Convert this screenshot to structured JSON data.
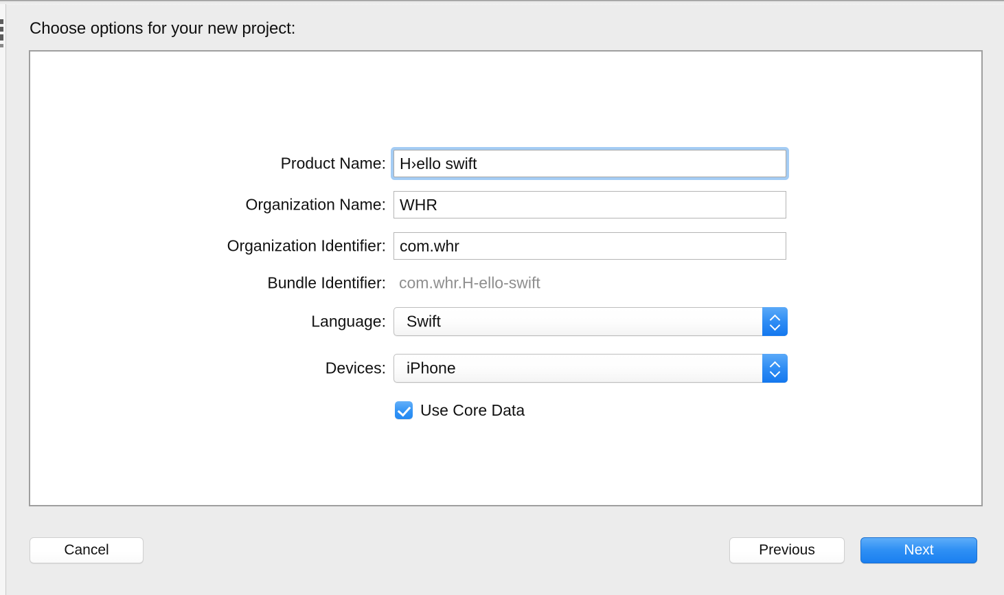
{
  "window": {
    "heading": "Choose options for your new project:"
  },
  "form": {
    "rows": [
      {
        "label": "Product Name:",
        "value": "H›ello swift",
        "type": "textfield",
        "focused": true
      },
      {
        "label": "Organization Name:",
        "value": "WHR",
        "type": "textfield",
        "focused": false
      },
      {
        "label": "Organization Identifier:",
        "value": "com.whr",
        "type": "textfield",
        "focused": false
      },
      {
        "label": "Bundle Identifier:",
        "value": "com.whr.H-ello-swift",
        "type": "static",
        "focused": false
      },
      {
        "label": "Language:",
        "value": "Swift",
        "type": "popup",
        "focused": false
      },
      {
        "label": "Devices:",
        "value": "iPhone",
        "type": "popup",
        "focused": false
      }
    ],
    "checkbox": {
      "label": "Use Core Data",
      "checked": true
    }
  },
  "footer": {
    "cancel_label": "Cancel",
    "previous_label": "Previous",
    "next_label": "Next"
  },
  "colors": {
    "accent_blue": "#2f90f4",
    "focus_ring": "#a4ccf4",
    "window_bg": "#ececec",
    "panel_bg": "#ffffff",
    "panel_border": "#9e9e9e",
    "disabled_text": "#8e8e8e"
  }
}
